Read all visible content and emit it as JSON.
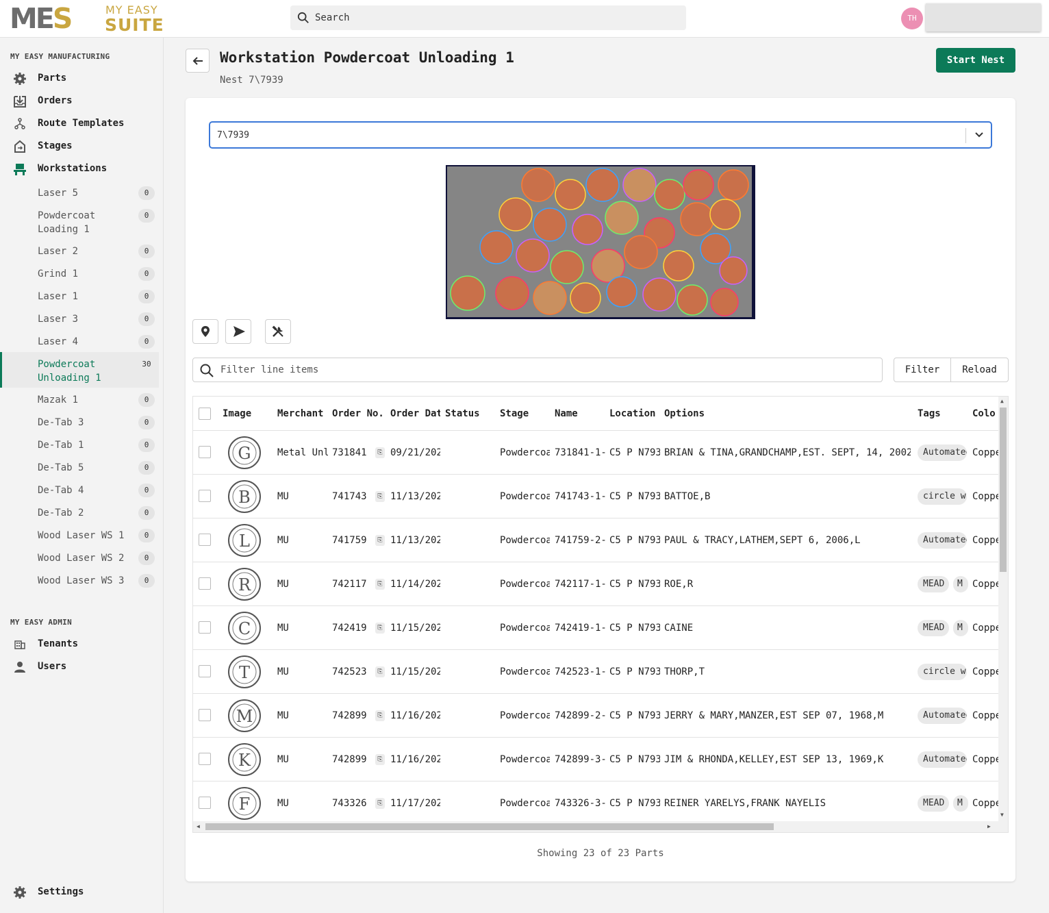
{
  "brand": {
    "mes": "MES",
    "my_easy": "MY EASY",
    "suite": "SUITE",
    "accent": "#c9a640"
  },
  "search": {
    "placeholder": "Search"
  },
  "user": {
    "initials": "TH"
  },
  "sidebar": {
    "manufacturing_title": "MY EASY MANUFACTURING",
    "main_items": [
      {
        "label": "Parts",
        "icon": "gear-icon"
      },
      {
        "label": "Orders",
        "icon": "inbox-download-icon"
      },
      {
        "label": "Route Templates",
        "icon": "route-icon"
      },
      {
        "label": "Stages",
        "icon": "stages-icon"
      },
      {
        "label": "Workstations",
        "icon": "workstation-icon"
      }
    ],
    "workstations": [
      {
        "label": "Laser 5",
        "count": "0"
      },
      {
        "label": "Powdercoat Loading 1",
        "count": "0"
      },
      {
        "label": "Laser 2",
        "count": "0"
      },
      {
        "label": "Grind 1",
        "count": "0"
      },
      {
        "label": "Laser 1",
        "count": "0"
      },
      {
        "label": "Laser 3",
        "count": "0"
      },
      {
        "label": "Laser 4",
        "count": "0"
      },
      {
        "label": "Powdercoat Unloading 1",
        "count": "30"
      },
      {
        "label": "Mazak 1",
        "count": "0"
      },
      {
        "label": "De-Tab 3",
        "count": "0"
      },
      {
        "label": "De-Tab 1",
        "count": "0"
      },
      {
        "label": "De-Tab 5",
        "count": "0"
      },
      {
        "label": "De-Tab 4",
        "count": "0"
      },
      {
        "label": "De-Tab 2",
        "count": "0"
      },
      {
        "label": "Wood Laser WS 1",
        "count": "0"
      },
      {
        "label": "Wood Laser WS 2",
        "count": "0"
      },
      {
        "label": "Wood Laser WS 3",
        "count": "0"
      }
    ],
    "admin_title": "MY EASY ADMIN",
    "admin_items": [
      {
        "label": "Tenants",
        "icon": "building-icon"
      },
      {
        "label": "Users",
        "icon": "user-icon"
      }
    ],
    "settings": {
      "label": "Settings",
      "icon": "gear-icon"
    }
  },
  "page": {
    "title": "Workstation Powdercoat Unloading 1",
    "subtitle": "Nest 7\\7939",
    "start_button": "Start Nest",
    "primary_color": "#0c7a58"
  },
  "nest_select": {
    "value": "7\\7939"
  },
  "filter": {
    "placeholder": "Filter line items",
    "filter_label": "Filter",
    "reload_label": "Reload"
  },
  "table": {
    "headers": [
      "Image",
      "Merchant",
      "Order No.",
      "Order Dat",
      "Status",
      "Stage",
      "Name",
      "Location",
      "Options",
      "Tags",
      "Colo"
    ],
    "rows": [
      {
        "merchant": "Metal Unl",
        "order_no": "731841",
        "order_date": "09/21/202",
        "status": "",
        "stage": "Powdercoa",
        "name": "731841-1-",
        "location": "C5 P N793",
        "options": "BRIAN & TINA,GRANDCHAMP,EST. SEPT, 14, 2002",
        "tag1": "Automated",
        "tag2": "",
        "color": "Coppe",
        "thumb_letter": "G"
      },
      {
        "merchant": "MU",
        "order_no": "741743",
        "order_date": "11/13/202",
        "status": "",
        "stage": "Powdercoa",
        "name": "741743-1-",
        "location": "C5 P N793",
        "options": "BATTOE,B",
        "tag1": "circle w",
        "tag2": "",
        "color": "Coppe",
        "thumb_letter": "B"
      },
      {
        "merchant": "MU",
        "order_no": "741759",
        "order_date": "11/13/202",
        "status": "",
        "stage": "Powdercoa",
        "name": "741759-2-",
        "location": "C5 P N793",
        "options": "PAUL & TRACY,LATHEM,SEPT 6, 2006,L",
        "tag1": "Automated",
        "tag2": "",
        "color": "Coppe",
        "thumb_letter": "L"
      },
      {
        "merchant": "MU",
        "order_no": "742117",
        "order_date": "11/14/202",
        "status": "",
        "stage": "Powdercoa",
        "name": "742117-1-",
        "location": "C5 P N793",
        "options": "ROE,R",
        "tag1": "MEAD",
        "tag2": "M",
        "color": "Coppe",
        "thumb_letter": "R"
      },
      {
        "merchant": "MU",
        "order_no": "742419",
        "order_date": "11/15/202",
        "status": "",
        "stage": "Powdercoa",
        "name": "742419-1-",
        "location": "C5 P N793",
        "options": "CAINE",
        "tag1": "MEAD",
        "tag2": "M",
        "color": "Coppe",
        "thumb_letter": "C"
      },
      {
        "merchant": "MU",
        "order_no": "742523",
        "order_date": "11/15/202",
        "status": "",
        "stage": "Powdercoa",
        "name": "742523-1-",
        "location": "C5 P N793",
        "options": "THORP,T",
        "tag1": "circle w",
        "tag2": "",
        "color": "Coppe",
        "thumb_letter": "T"
      },
      {
        "merchant": "MU",
        "order_no": "742899",
        "order_date": "11/16/202",
        "status": "",
        "stage": "Powdercoa",
        "name": "742899-2-",
        "location": "C5 P N793",
        "options": "JERRY & MARY,MANZER,EST SEP 07, 1968,M",
        "tag1": "Automated",
        "tag2": "",
        "color": "Coppe",
        "thumb_letter": "M"
      },
      {
        "merchant": "MU",
        "order_no": "742899",
        "order_date": "11/16/202",
        "status": "",
        "stage": "Powdercoa",
        "name": "742899-3-",
        "location": "C5 P N793",
        "options": "JIM & RHONDA,KELLEY,EST SEP 13, 1969,K",
        "tag1": "Automated",
        "tag2": "",
        "color": "Coppe",
        "thumb_letter": "K"
      },
      {
        "merchant": "MU",
        "order_no": "743326",
        "order_date": "11/17/202",
        "status": "",
        "stage": "Powdercoa",
        "name": "743326-3-",
        "location": "C5 P N793",
        "options": "REINER YARELYS,FRANK NAYELIS",
        "tag1": "MEAD",
        "tag2": "M",
        "color": "Coppe",
        "thumb_letter": "F"
      }
    ]
  },
  "footer": {
    "showing": "Showing 23 of 23 Parts"
  }
}
